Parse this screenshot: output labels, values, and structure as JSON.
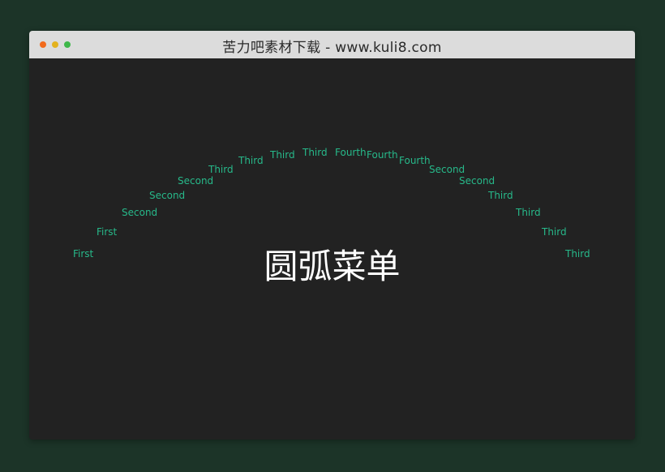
{
  "window": {
    "title": "苦力吧素材下载 - www.kuli8.com",
    "buttons": {
      "close_color": "#f26b1d",
      "minimize_color": "#e3b21f",
      "maximize_color": "#3fb84a"
    }
  },
  "page": {
    "heading": "圆弧菜单"
  },
  "menu": {
    "text_color": "#27b98a",
    "items": [
      {
        "label": "First"
      },
      {
        "label": "First"
      },
      {
        "label": "Second"
      },
      {
        "label": "Second"
      },
      {
        "label": "Second"
      },
      {
        "label": "Third"
      },
      {
        "label": "Third"
      },
      {
        "label": "Third"
      },
      {
        "label": "Third"
      },
      {
        "label": "Fourth"
      },
      {
        "label": "Fourth"
      },
      {
        "label": "Fourth"
      },
      {
        "label": "Second"
      },
      {
        "label": "Second"
      },
      {
        "label": "Third"
      },
      {
        "label": "Third"
      },
      {
        "label": "Third"
      },
      {
        "label": "Third"
      }
    ]
  }
}
